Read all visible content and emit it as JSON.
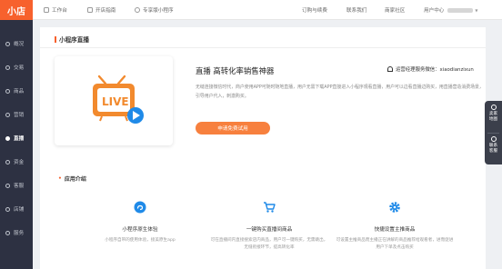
{
  "app": {
    "logo": "小店"
  },
  "topbar": {
    "links": [
      {
        "label": "工作台",
        "icon": "workbench-icon"
      },
      {
        "label": "开店指南",
        "icon": "guide-icon"
      },
      {
        "label": "专享版小程序",
        "icon": "mini-program-icon"
      }
    ],
    "right_links": [
      "订购与续费",
      "联系我们",
      "商家社区",
      "用户中心"
    ]
  },
  "sidebar": {
    "items": [
      {
        "label": "概况",
        "icon": "home-icon"
      },
      {
        "label": "交易",
        "icon": "trade-icon"
      },
      {
        "label": "商品",
        "icon": "goods-icon"
      },
      {
        "label": "营销",
        "icon": "marketing-icon"
      },
      {
        "label": "直播",
        "icon": "live-icon",
        "active": true
      },
      {
        "label": "资金",
        "icon": "funds-icon"
      },
      {
        "label": "客服",
        "icon": "customer-service-icon"
      },
      {
        "label": "店铺",
        "icon": "shop-icon"
      },
      {
        "label": "服务",
        "icon": "service-icon"
      }
    ]
  },
  "main": {
    "page_title": "小程序直播",
    "hero": {
      "title": "直播 高转化率销售神器",
      "contact_label": "运营经理服务微信：xiaodianzixun",
      "description": "无缝连接微信时代，商户使用APP可随时随地直播，用户无需下载APP直接进入小程序观看直播，用户可以边看直播边购买，用直播营造消费场景，引导用户代入，刺激购买。",
      "button_label": "申请免费试用",
      "badge_text": "LIVE"
    },
    "app_intro_title": "应用介绍",
    "features": [
      {
        "title": "小程序原生体验",
        "desc": "小程序自带的使用体验，接美原生app",
        "icon": "mini-program-native-icon"
      },
      {
        "title": "一键购买直播间商品",
        "desc": "可在直播间内直接搜索店内商品，用户可一键购买，无需跳出，无缝衔接环节，提高转化率",
        "icon": "cart-icon"
      },
      {
        "title": "快捷设置主推商品",
        "desc": "可设置主推商品而主播正在讲解的商品推荐给观看者，进而促进用户下单及点击购买",
        "icon": "gear-icon"
      }
    ]
  },
  "float_panel": {
    "items": [
      {
        "label": "卖家地图",
        "icon": "map-icon"
      },
      {
        "label": "联系客服",
        "icon": "chat-icon"
      }
    ]
  },
  "colors": {
    "accent": "#f7612d",
    "button": "#f7803e",
    "sidebar_bg": "#2d3142",
    "feature_blue": "#1f8ae8"
  }
}
